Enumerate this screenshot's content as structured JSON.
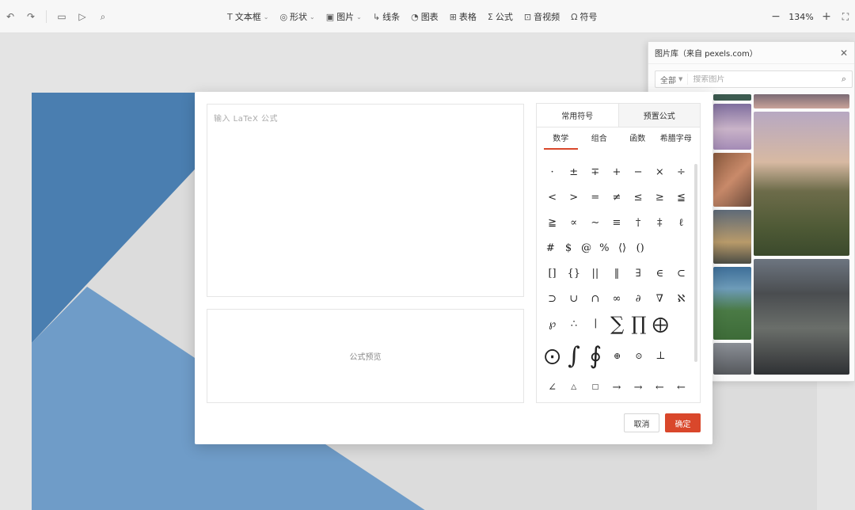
{
  "toolbar": {
    "items": [
      {
        "icon": "T",
        "label": "文本框",
        "caret": "⌄"
      },
      {
        "icon": "◎",
        "label": "形状",
        "caret": "⌄"
      },
      {
        "icon": "▣",
        "label": "图片",
        "caret": "⌄"
      },
      {
        "icon": "↳",
        "label": "线条",
        "caret": ""
      },
      {
        "icon": "◔",
        "label": "图表",
        "caret": ""
      },
      {
        "icon": "⊞",
        "label": "表格",
        "caret": ""
      },
      {
        "icon": "Σ",
        "label": "公式",
        "caret": ""
      },
      {
        "icon": "⊡",
        "label": "音视频",
        "caret": ""
      },
      {
        "icon": "Ω",
        "label": "符号",
        "caret": ""
      }
    ],
    "zoom": "134%",
    "zoom_minus": "−",
    "zoom_plus": "+"
  },
  "image_panel": {
    "title": "图片库（来自 pexels.com）",
    "filter": "全部",
    "search_placeholder": "搜索图片"
  },
  "dialog": {
    "input_placeholder": "输入 LaTeX 公式",
    "preview_label": "公式预览",
    "tabs": [
      "常用符号",
      "预置公式"
    ],
    "subtabs": [
      "数学",
      "组合",
      "函数",
      "希腊字母"
    ],
    "symbols": [
      [
        "·",
        "±",
        "∓",
        "+",
        "−",
        "×",
        "÷"
      ],
      [
        "<",
        ">",
        "=",
        "≠",
        "≤",
        "≥",
        "≦"
      ],
      [
        "≧",
        "∝",
        "∼",
        "≡",
        "†",
        "‡",
        "ℓ"
      ],
      [
        "#",
        "$",
        "@",
        "%",
        "⟨⟩",
        "()"
      ],
      [
        "[]",
        "{}",
        "||",
        "‖",
        "∃",
        "∈",
        "⊂"
      ],
      [
        "⊃",
        "∪",
        "∩",
        "∞",
        "∂",
        "∇",
        "ℵ"
      ],
      [
        "℘",
        "∴",
        "∣",
        "∑",
        "∏",
        "⨁"
      ],
      [
        "⨀",
        "∫",
        "∮",
        "⊕",
        "⊙",
        "⊥"
      ],
      [
        "∠",
        "△",
        "□",
        "→",
        "→",
        "←",
        "←"
      ]
    ],
    "cancel_label": "取消",
    "ok_label": "确定"
  },
  "colors": {
    "accent": "#d9472b",
    "slide_blue": "#4a7eb0",
    "slide_light_blue": "#6f9cc8"
  }
}
